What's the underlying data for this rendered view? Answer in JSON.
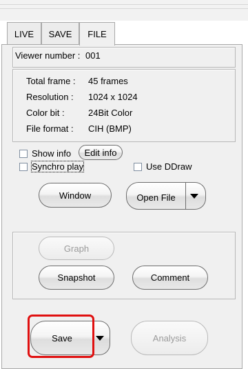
{
  "tabs": [
    {
      "label": "LIVE",
      "active": false
    },
    {
      "label": "SAVE",
      "active": false
    },
    {
      "label": "FILE",
      "active": true
    }
  ],
  "viewer": {
    "label": "Viewer number :",
    "value": "001"
  },
  "file_info": {
    "total_frame_label": "Total frame :",
    "total_frame_value": "45 frames",
    "resolution_label": "Resolution :",
    "resolution_value": "1024 x 1024",
    "color_bit_label": "Color bit :",
    "color_bit_value": "24Bit Color",
    "file_format_label": "File format :",
    "file_format_value": "CIH (BMP)"
  },
  "options": {
    "show_info": "Show info",
    "edit_info": "Edit info",
    "synchro_play": "Synchro play",
    "use_ddraw": "Use DDraw"
  },
  "buttons": {
    "window": "Window",
    "open_file": "Open File",
    "graph": "Graph",
    "snapshot": "Snapshot",
    "comment": "Comment",
    "save": "Save",
    "analysis": "Analysis"
  },
  "colors": {
    "highlight": "#e01010"
  }
}
